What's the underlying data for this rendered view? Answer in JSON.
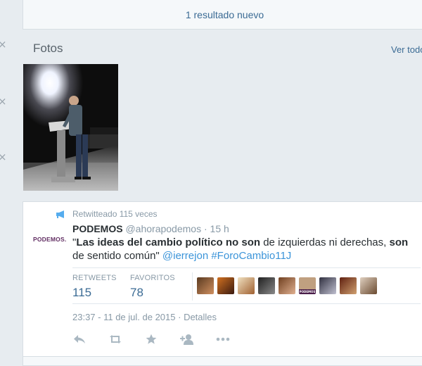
{
  "new_results": "1 resultado nuevo",
  "photos": {
    "title": "Fotos",
    "see_all": "Ver todo"
  },
  "left_rail": {
    "close_glyph": "×"
  },
  "tweet": {
    "retweet_line": "Retwitteado 115 veces",
    "logo_text": "PODEMOS.",
    "fullname": "PODEMOS",
    "username": "@ahorapodemos",
    "dot": "·",
    "time": "15 h",
    "text": {
      "q_open": "\"",
      "b1": "Las ideas del cambio político no son",
      "t1": " de izquierdas ni derechas, ",
      "b2": "son",
      "t2": " de sentido común\" ",
      "mention": "@ierrejon",
      "space": " ",
      "hashtag": "#ForoCambio11J"
    },
    "stats": {
      "retweets_label": "RETWEETS",
      "retweets_value": "115",
      "favorites_label": "FAVORITOS",
      "favorites_value": "78"
    },
    "faces_overlay_text": "PODEMOS",
    "timestamp": "23:37 - 11 de jul. de 2015",
    "timestamp_sep": " · ",
    "details": "Detalles",
    "actions": [
      "reply-icon",
      "retweet-icon",
      "favorite-icon",
      "follow-icon",
      "more-icon"
    ]
  },
  "colors": {
    "link": "#3b94d9",
    "dark_link": "#3b6b94",
    "muted": "#8899a6",
    "podemos_purple": "#612d62"
  }
}
